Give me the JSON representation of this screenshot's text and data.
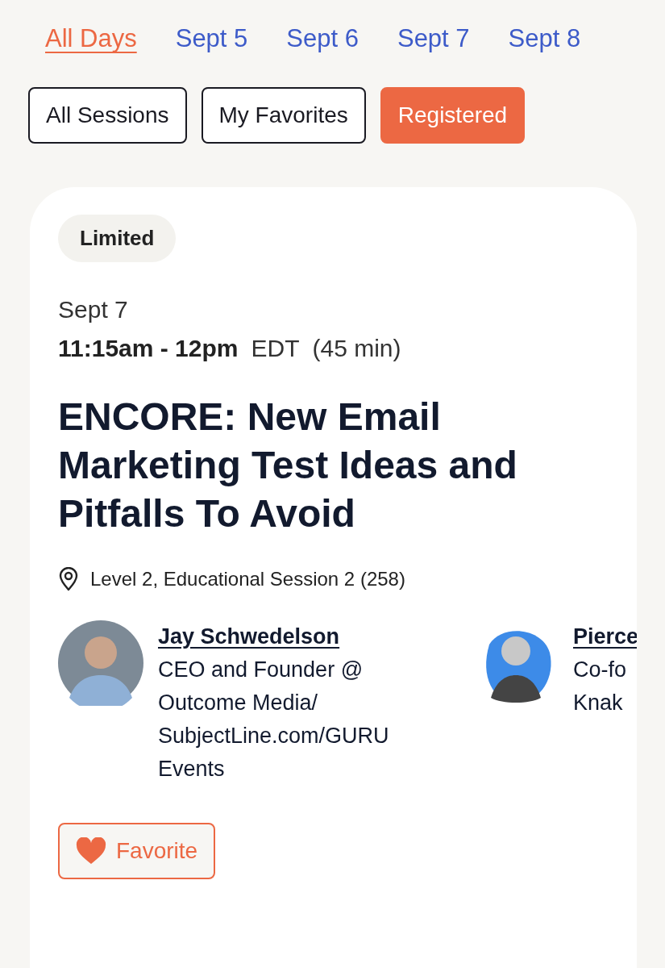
{
  "day_tabs": [
    {
      "label": "All Days",
      "selected": true
    },
    {
      "label": "Sept 5",
      "selected": false
    },
    {
      "label": "Sept 6",
      "selected": false
    },
    {
      "label": "Sept 7",
      "selected": false
    },
    {
      "label": "Sept 8",
      "selected": false
    }
  ],
  "filters": [
    {
      "label": "All Sessions",
      "selected": false
    },
    {
      "label": "My Favorites",
      "selected": false
    },
    {
      "label": "Registered",
      "selected": true
    }
  ],
  "session": {
    "badge": "Limited",
    "date": "Sept 7",
    "time": "11:15am - 12pm",
    "timezone": "EDT",
    "duration": "(45 min)",
    "title": "ENCORE: New Email Marketing Test Ideas and Pitfalls To Avoid",
    "location": "Level 2, Educational Session 2 (258)",
    "speakers": [
      {
        "name": "Jay Schwedelson",
        "role": "CEO and Founder @ Outcome Media/ SubjectLine.com/GURU Events",
        "kind": "photo"
      },
      {
        "name": "Pierce",
        "role": "Co-fo Knak",
        "kind": "cutout"
      }
    ],
    "favorite_button": "Favorite"
  }
}
